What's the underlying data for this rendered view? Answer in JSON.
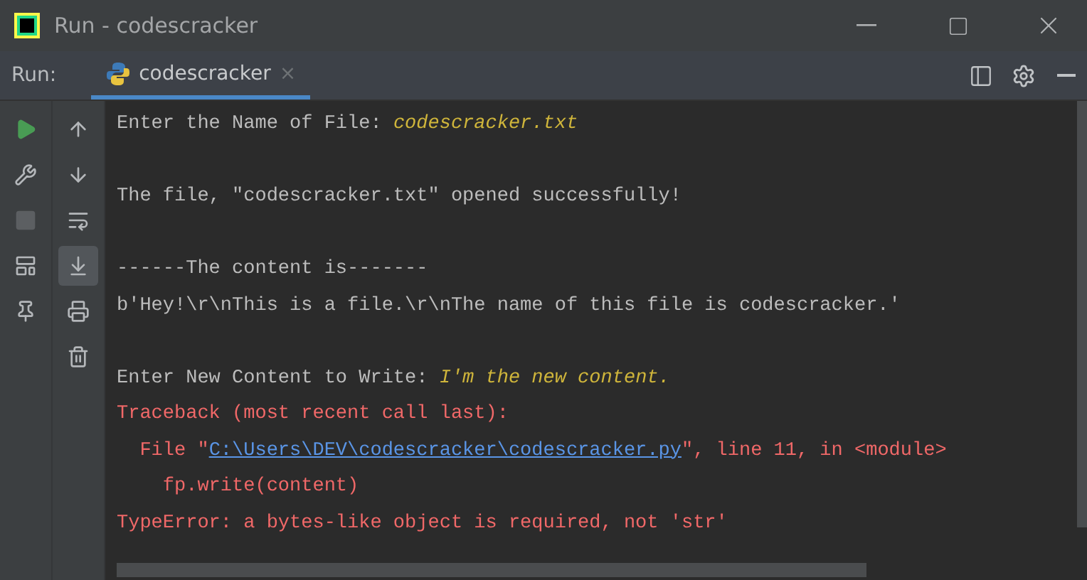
{
  "window": {
    "title": "Run - codescracker"
  },
  "run_bar": {
    "label": "Run:",
    "tabs": [
      {
        "label": "codescracker",
        "close": "×",
        "selected": true
      }
    ]
  },
  "left_tools": [
    {
      "disabled": false
    },
    {
      "disabled": false
    },
    {
      "disabled": true
    },
    {
      "disabled": false
    },
    {
      "disabled": false
    }
  ],
  "console_tools": [
    {
      "selected": false
    },
    {
      "selected": false
    },
    {
      "selected": false
    },
    {
      "selected": true
    },
    {
      "selected": false
    },
    {
      "selected": false
    }
  ],
  "console": [
    {
      "lines": [
        {
          "segments": [
            {
              "kind": "plain",
              "text": "Enter the Name of File: "
            },
            {
              "kind": "input",
              "text": "codescracker.txt"
            }
          ]
        }
      ]
    },
    {
      "lines": [
        {
          "segments": [
            {
              "kind": "plain",
              "text": "The file, \"codescracker.txt\" opened successfully!"
            }
          ]
        }
      ]
    },
    {
      "lines": [
        {
          "segments": [
            {
              "kind": "plain",
              "text": "------The content is-------"
            }
          ]
        },
        {
          "segments": [
            {
              "kind": "plain",
              "text": "b'Hey!\\r\\nThis is a file.\\r\\nThe name of this file is codescracker.'"
            }
          ]
        }
      ]
    },
    {
      "lines": [
        {
          "segments": [
            {
              "kind": "plain",
              "text": "Enter New Content to Write: "
            },
            {
              "kind": "input",
              "text": "I'm the new content."
            }
          ]
        },
        {
          "segments": [
            {
              "kind": "error",
              "text": "Traceback (most recent call last):"
            }
          ]
        },
        {
          "segments": [
            {
              "kind": "error",
              "text": "  File \""
            },
            {
              "kind": "link",
              "text": "C:\\Users\\DEV\\codescracker\\codescracker.py"
            },
            {
              "kind": "error",
              "text": "\", line 11, in <module>"
            }
          ]
        },
        {
          "segments": [
            {
              "kind": "error",
              "text": "    fp.write(content)"
            }
          ]
        },
        {
          "segments": [
            {
              "kind": "error",
              "text": "TypeError: a bytes-like object is required, not 'str'"
            }
          ]
        }
      ]
    }
  ]
}
